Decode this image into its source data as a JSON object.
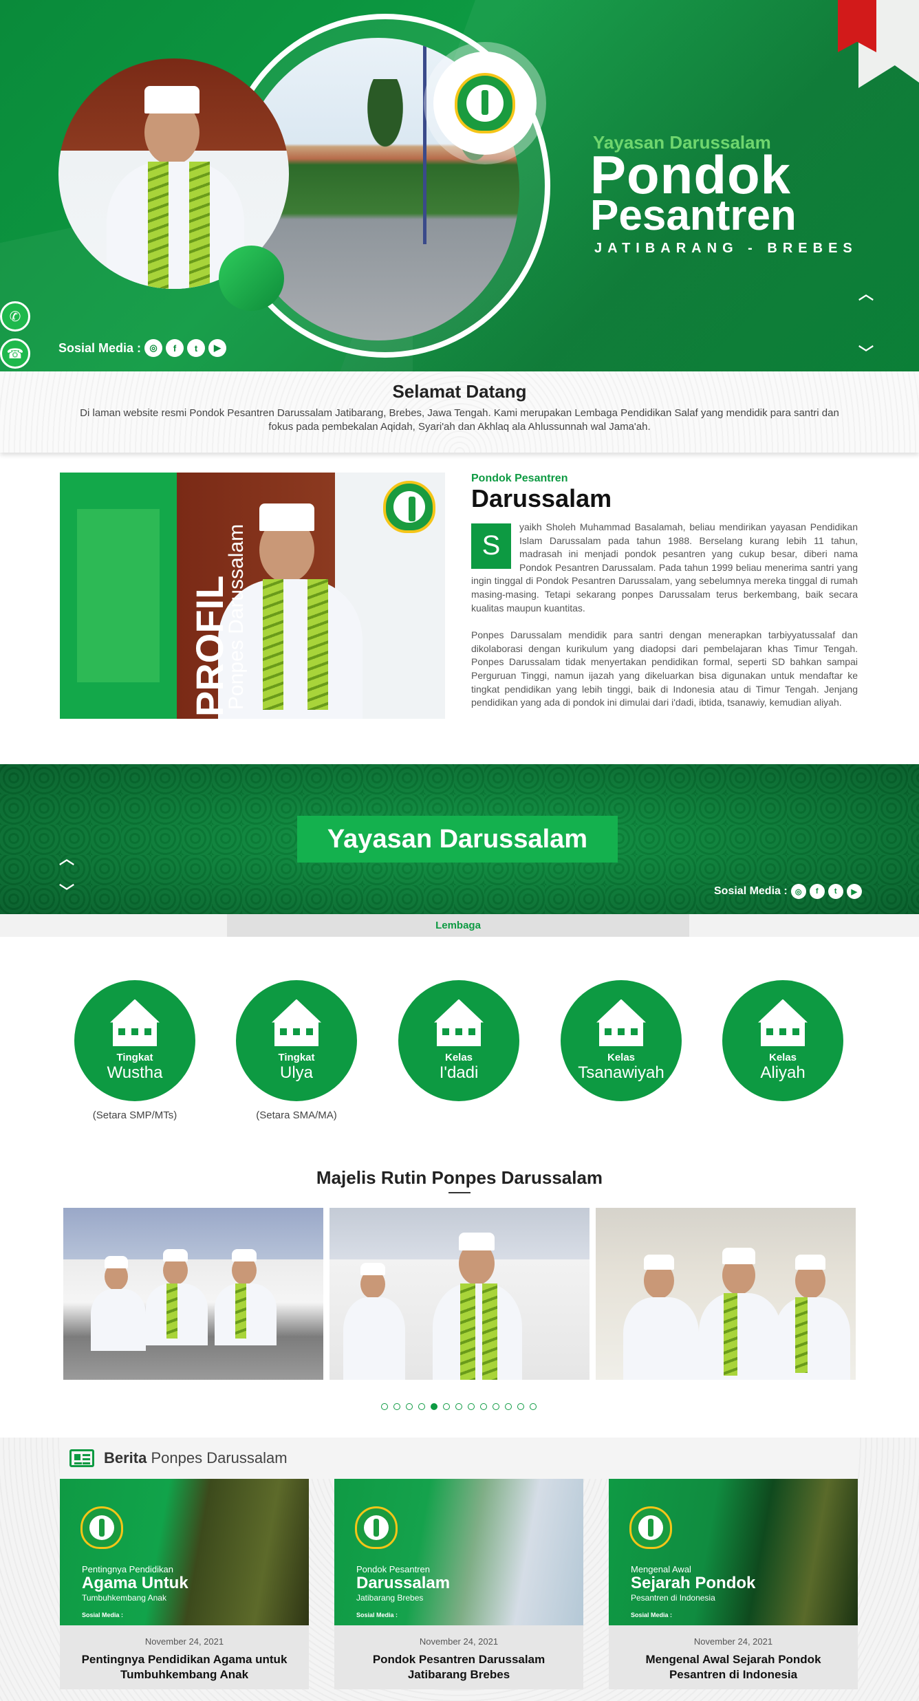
{
  "hero": {
    "subtitle": "Yayasan Darussalam",
    "title_line1": "Pondok",
    "title_line2": "Pesantren",
    "place": "JATIBARANG - BREBES",
    "social_label": "Sosial Media :",
    "social_icons": [
      "instagram-icon",
      "facebook-icon",
      "twitter-icon",
      "youtube-icon"
    ],
    "arrow_up": "︿",
    "arrow_down": "﹀"
  },
  "floating": {
    "whatsapp": "✆",
    "phone": "☎"
  },
  "welcome": {
    "title": "Selamat Datang",
    "text": "Di laman website resmi Pondok Pesantren Darussalam Jatibarang, Brebes, Jawa Tengah. Kami merupakan Lembaga Pendidikan Salaf yang mendidik para santri dan fokus pada pembekalan Aqidah, Syari'ah dan Akhlaq ala Ahlussunnah wal Jama'ah."
  },
  "profile": {
    "image_title": "PROFIL",
    "image_subtitle": "Ponpes Darussalam",
    "kicker": "Pondok Pesantren",
    "heading": "Darussalam",
    "drop_cap": "S",
    "para1": "yaikh Sholeh Muhammad Basalamah, beliau mendirikan yayasan Pendidikan Islam Darussalam pada tahun 1988. Berselang kurang lebih 11 tahun, madrasah ini menjadi pondok pesantren yang cukup besar, diberi nama Pondok Pesantren Darussalam. Pada tahun 1999 beliau menerima santri yang ingin tinggal di Pondok Pesantren Darussalam, yang sebelumnya mereka tinggal di rumah masing-masing. Tetapi sekarang ponpes Darussalam terus berkembang, baik secara kualitas maupun kuantitas.",
    "para2": "Ponpes Darussalam mendidik para santri dengan menerapkan tarbiyyatussalaf dan dikolaborasi dengan kurikulum yang diadopsi dari pembelajaran khas Timur Tengah. Ponpes Darussalam tidak menyertakan pendidikan formal, seperti SD bahkan sampai Perguruan Tinggi, namun ijazah yang dikeluarkan bisa digunakan untuk mendaftar ke tingkat pendidikan yang lebih tinggi, baik di Indonesia atau di Timur Tengah. Jenjang pendidikan yang ada di pondok ini dimulai dari i'dadi, ibtida, tsanawiy, kemudian aliyah."
  },
  "banner": {
    "label": "Yayasan Darussalam",
    "social_label": "Sosial Media :",
    "tab": "Lembaga"
  },
  "lembaga": [
    {
      "small": "Tingkat",
      "big": "Wustha",
      "note": "(Setara SMP/MTs)"
    },
    {
      "small": "Tingkat",
      "big": "Ulya",
      "note": "(Setara SMA/MA)"
    },
    {
      "small": "Kelas",
      "big": "I'dadi",
      "note": ""
    },
    {
      "small": "Kelas",
      "big": "Tsanawiyah",
      "note": ""
    },
    {
      "small": "Kelas",
      "big": "Aliyah",
      "note": ""
    }
  ],
  "majelis": {
    "title": "Majelis Rutin Ponpes Darussalam",
    "dot_count": 13,
    "active_dot": 4
  },
  "berita": {
    "title_bold": "Berita",
    "title_rest": " Ponpes Darussalam",
    "cards": [
      {
        "thumb_l1": "Pentingnya Pendidikan",
        "thumb_l2": "Agama Untuk",
        "thumb_l3": "Tumbuhkembang Anak",
        "thumb_social": "Sosial Media :",
        "date": "November 24, 2021",
        "title": "Pentingnya Pendidikan Agama untuk Tumbuhkembang Anak"
      },
      {
        "thumb_l1": "Pondok Pesantren",
        "thumb_l2": "Darussalam",
        "thumb_l3": "Jatibarang Brebes",
        "thumb_social": "Sosial Media :",
        "date": "November 24, 2021",
        "title": "Pondok Pesantren Darussalam Jatibarang Brebes"
      },
      {
        "thumb_l1": "Mengenal Awal",
        "thumb_l2": "Sejarah Pondok",
        "thumb_l3": "Pesantren di Indonesia",
        "thumb_social": "Sosial Media :",
        "date": "November 24, 2021",
        "title": "Mengenal Awal Sejarah Pondok Pesantren di Indonesia"
      }
    ]
  },
  "colors": {
    "brand_green": "#0d9a42",
    "light_green": "#6fd66e",
    "ribbon_red": "#d21a1a"
  }
}
